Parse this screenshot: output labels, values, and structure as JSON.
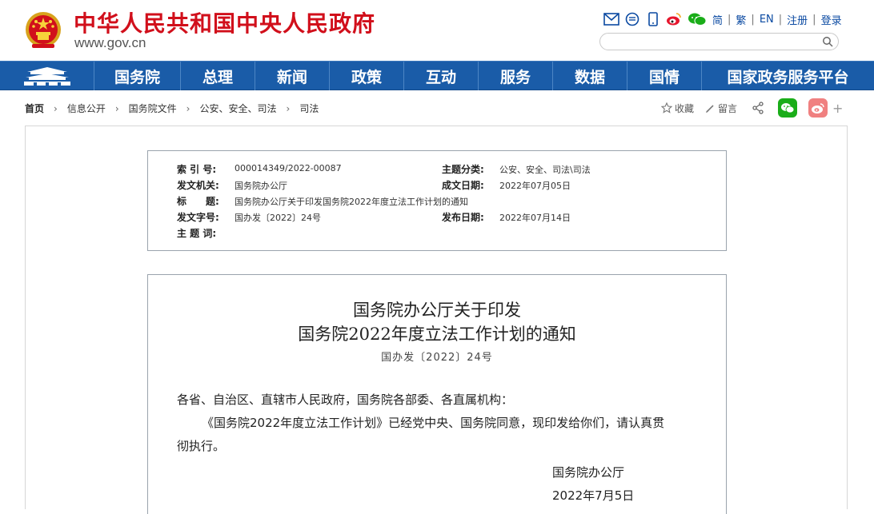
{
  "header": {
    "site_title": "中华人民共和国中央人民政府",
    "site_url": "www.gov.cn",
    "tools": {
      "icons": [
        "mail-icon",
        "message-icon",
        "mobile-icon",
        "weibo-icon",
        "wechat-icon"
      ],
      "links": [
        "简",
        "繁",
        "EN",
        "注册",
        "登录"
      ]
    },
    "search": {
      "placeholder": ""
    }
  },
  "nav": {
    "items": [
      "国务院",
      "总理",
      "新闻",
      "政策",
      "互动",
      "服务",
      "数据",
      "国情",
      "国家政务服务平台"
    ]
  },
  "breadcrumb": {
    "home": "首页",
    "items": [
      "信息公开",
      "国务院文件",
      "公安、安全、司法",
      "司法"
    ]
  },
  "share": {
    "favorite": "收藏",
    "comment": "留言",
    "plus": "+"
  },
  "meta": {
    "index_no_label": "索 引 号:",
    "index_no": "000014349/2022-00087",
    "category_label": "主题分类:",
    "category": "公安、安全、司法\\司法",
    "issuer_label": "发文机关:",
    "issuer": "国务院办公厅",
    "created_label": "成文日期:",
    "created": "2022年07月05日",
    "title_label": "标　　题:",
    "title": "国务院办公厅关于印发国务院2022年度立法工作计划的通知",
    "doc_no_label": "发文字号:",
    "doc_no": "国办发〔2022〕24号",
    "published_label": "发布日期:",
    "published": "2022年07月14日",
    "keywords_label": "主 题 词:",
    "keywords": ""
  },
  "article": {
    "title_line1": "国务院办公厅关于印发",
    "title_line2": "国务院2022年度立法工作计划的通知",
    "doc_number": "国办发〔2022〕24号",
    "salutation": "各省、自治区、直辖市人民政府，国务院各部委、各直属机构：",
    "body_line1": "《国务院2022年度立法工作计划》已经党中央、国务院同意，现印发给你们，请认真贯",
    "body_line2": "彻执行。",
    "signer": "国务院办公厅",
    "date": "2022年7月5日"
  },
  "colors": {
    "title_red": "#d10f1b",
    "nav_blue": "#1a5ca8",
    "link_blue": "#0b4aa2",
    "wechat_green": "#1aad19",
    "weibo_red": "#e6162d"
  }
}
